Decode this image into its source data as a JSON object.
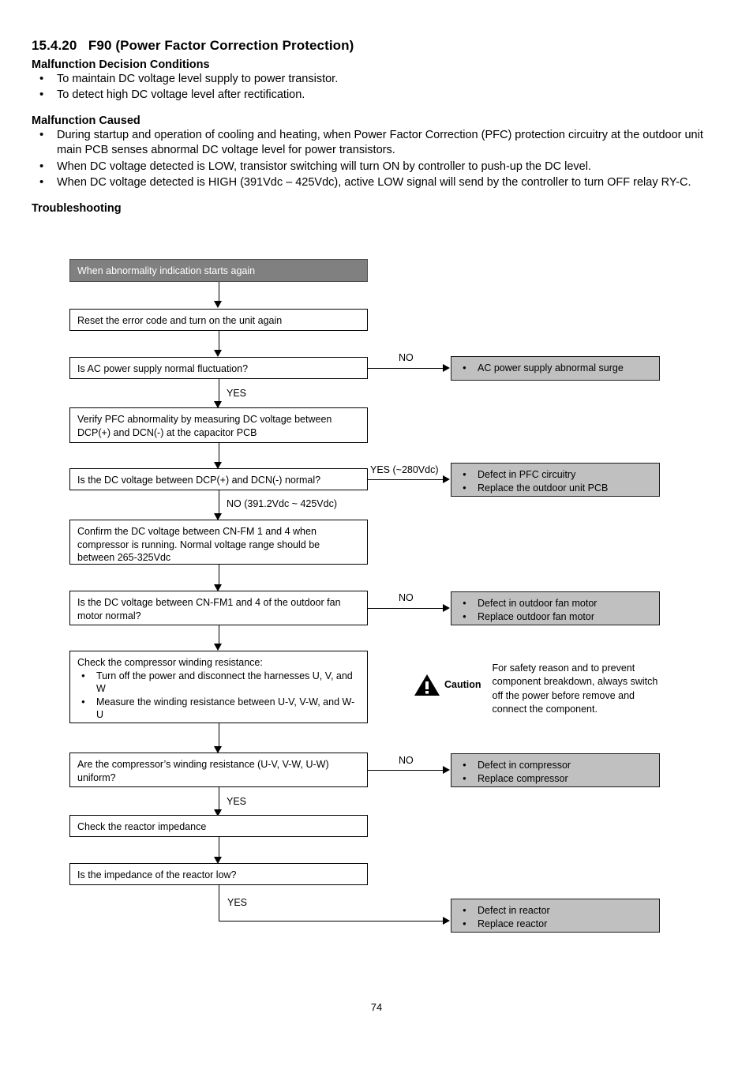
{
  "document": {
    "section_number": "15.4.20",
    "section_title": "F90 (Power Factor Correction Protection)",
    "page_number": "74"
  },
  "decision_conditions": {
    "heading": "Malfunction Decision Conditions",
    "items": [
      "To maintain DC voltage level supply to power transistor.",
      "To detect high DC voltage level after rectification."
    ]
  },
  "malfunction_caused": {
    "heading": "Malfunction Caused",
    "items": [
      "During startup and operation of cooling and heating, when Power Factor Correction (PFC) protection circuitry at the outdoor unit main PCB senses abnormal DC voltage level for power transistors.",
      "When DC voltage detected is LOW, transistor switching will turn ON by controller to push-up the DC level.",
      "When DC voltage detected is HIGH (391Vdc – 425Vdc), active LOW signal will send by the controller to turn OFF relay RY-C."
    ]
  },
  "troubleshooting": {
    "heading": "Troubleshooting",
    "colors": {
      "header_fill": "#808080",
      "header_text": "#ffffff",
      "result_fill": "#c0c0c0",
      "box_border": "#000000"
    },
    "start_box": "When abnormality indication starts again",
    "steps": {
      "reset": "Reset the error code and turn on the unit again",
      "ac_check": "Is AC power supply normal fluctuation?",
      "verify_pfc_line1": "Verify PFC abnormality by measuring DC voltage between",
      "verify_pfc_line2": "DCP(+) and DCN(-) at the capacitor PCB",
      "dc_normal_check": "Is the DC voltage between DCP(+) and DCN(-) normal?",
      "confirm_cnfm_line1": "Confirm the DC voltage between CN-FM 1 and 4 when",
      "confirm_cnfm_line2": "compressor is running. Normal voltage range should be",
      "confirm_cnfm_line3": "between 265-325Vdc",
      "cnfm_normal_check_line1": "Is the DC voltage between CN-FM1 and 4 of the outdoor fan",
      "cnfm_normal_check_line2": "motor normal?",
      "winding_lead": "Check the compressor winding resistance:",
      "winding_item1": "Turn off the power and disconnect the harnesses U, V, and W",
      "winding_item2": "Measure the winding resistance between U-V, V-W, and W-U",
      "winding_uniform_line1": "Are the compressor’s winding resistance (U-V, V-W, U-W)",
      "winding_uniform_line2": "uniform?",
      "check_reactor": "Check the reactor impedance",
      "reactor_low_check": "Is the impedance of the reactor low?"
    },
    "results": {
      "ac_surge": [
        "AC power supply abnormal surge"
      ],
      "pfc_defect": [
        "Defect in PFC circuitry",
        "Replace the outdoor unit PCB"
      ],
      "fan_motor_defect": [
        "Defect in outdoor fan motor",
        "Replace outdoor fan motor"
      ],
      "compressor_defect": [
        "Defect in compressor",
        "Replace compressor"
      ],
      "reactor_defect": [
        "Defect in reactor",
        "Replace reactor"
      ]
    },
    "branch_labels": {
      "ac_no": "NO",
      "ac_yes": "YES",
      "dc_yes": "YES (~280Vdc)",
      "dc_no": "NO (391.2Vdc ~ 425Vdc)",
      "cnfm_no": "NO",
      "winding_no": "NO",
      "winding_yes": "YES",
      "reactor_yes": "YES"
    },
    "caution": {
      "label": "Caution",
      "line1": "For safety reason and to prevent",
      "line2": "component breakdown, always switch",
      "line3": "off the power before remove and",
      "line4": "connect the component."
    }
  }
}
